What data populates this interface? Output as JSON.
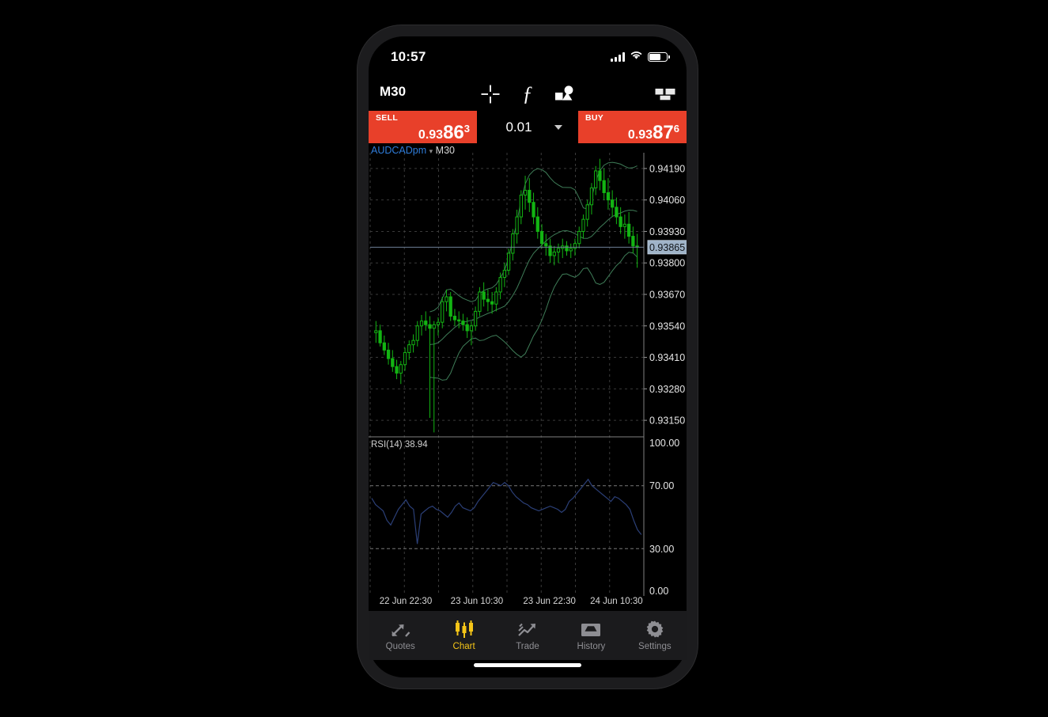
{
  "status_bar": {
    "time": "10:57",
    "signal_icon": "signal-bars-icon",
    "wifi_icon": "wifi-icon",
    "battery_icon": "battery-icon"
  },
  "toolbar": {
    "timeframe_label": "M30",
    "crosshair_icon": "crosshair-icon",
    "indicators_icon": "function-fx-icon",
    "objects_icon": "objects-icon",
    "layout_icon": "chart-layout-icon"
  },
  "trade_bar": {
    "sell": {
      "label": "SELL",
      "price_prefix": "0.93",
      "price_big": "86",
      "price_sup": "3",
      "full_price": "0.93863",
      "color": "#e8402a"
    },
    "buy": {
      "label": "BUY",
      "price_prefix": "0.93",
      "price_big": "87",
      "price_sup": "6",
      "full_price": "0.93876",
      "color": "#e8402a"
    },
    "volume": {
      "value": "0.01",
      "caret_icon": "chevron-down-icon"
    }
  },
  "chart_header": {
    "symbol": "AUDCADpm",
    "symbol_caret": "▾",
    "timeframe": "M30",
    "symbol_color": "#2f7ddb"
  },
  "chart_data": {
    "type": "line",
    "title": "AUDCADpm M30",
    "xlabel": "",
    "ylabel": "",
    "grid": true,
    "legend_position": "none",
    "panes": [
      {
        "name": "price",
        "type": "candlestick",
        "symbol": "AUDCADpm",
        "timeframe": "M30",
        "ylim": [
          0.93085,
          0.94255
        ],
        "yticks": [
          "0.94190",
          "0.94060",
          "0.93930",
          "0.93800",
          "0.93670",
          "0.93540",
          "0.93410",
          "0.93280",
          "0.93150"
        ],
        "ytick_values": [
          0.9419,
          0.9406,
          0.9393,
          0.938,
          0.9367,
          0.9354,
          0.9341,
          0.9328,
          0.9315
        ],
        "current_price": "0.93865",
        "current_price_value": 0.93865,
        "current_price_highlight_bg": "#9fb3c8",
        "bull_color": "#13b413",
        "bear_color": "#13b413",
        "overlays": [
          {
            "name": "Bollinger Upper",
            "color": "#3f7d58"
          },
          {
            "name": "Bollinger Middle",
            "color": "#3f7d58"
          },
          {
            "name": "Bollinger Lower",
            "color": "#3f7d58"
          }
        ],
        "candles": [
          {
            "o": 0.93512,
            "h": 0.9356,
            "l": 0.9347,
            "c": 0.9352
          },
          {
            "o": 0.9352,
            "h": 0.93545,
            "l": 0.93455,
            "c": 0.9347
          },
          {
            "o": 0.9347,
            "h": 0.935,
            "l": 0.9342,
            "c": 0.9344
          },
          {
            "o": 0.9344,
            "h": 0.9347,
            "l": 0.9338,
            "c": 0.93405
          },
          {
            "o": 0.93405,
            "h": 0.9344,
            "l": 0.9335,
            "c": 0.93372
          },
          {
            "o": 0.93372,
            "h": 0.934,
            "l": 0.9332,
            "c": 0.93345
          },
          {
            "o": 0.93345,
            "h": 0.93395,
            "l": 0.933,
            "c": 0.9338
          },
          {
            "o": 0.9338,
            "h": 0.9345,
            "l": 0.93355,
            "c": 0.9343
          },
          {
            "o": 0.9343,
            "h": 0.9348,
            "l": 0.934,
            "c": 0.93462
          },
          {
            "o": 0.93462,
            "h": 0.93505,
            "l": 0.9343,
            "c": 0.9348
          },
          {
            "o": 0.9348,
            "h": 0.9356,
            "l": 0.93455,
            "c": 0.9354
          },
          {
            "o": 0.9354,
            "h": 0.93585,
            "l": 0.935,
            "c": 0.9356
          },
          {
            "o": 0.9356,
            "h": 0.936,
            "l": 0.9352,
            "c": 0.93545
          },
          {
            "o": 0.93545,
            "h": 0.9358,
            "l": 0.9316,
            "c": 0.9353
          },
          {
            "o": 0.9353,
            "h": 0.9356,
            "l": 0.931,
            "c": 0.93545
          },
          {
            "o": 0.93545,
            "h": 0.93575,
            "l": 0.935,
            "c": 0.93555
          },
          {
            "o": 0.93555,
            "h": 0.9366,
            "l": 0.9353,
            "c": 0.9364
          },
          {
            "o": 0.9364,
            "h": 0.9369,
            "l": 0.936,
            "c": 0.9366
          },
          {
            "o": 0.9366,
            "h": 0.9368,
            "l": 0.9356,
            "c": 0.9358
          },
          {
            "o": 0.9358,
            "h": 0.9361,
            "l": 0.9354,
            "c": 0.93565
          },
          {
            "o": 0.93565,
            "h": 0.936,
            "l": 0.9353,
            "c": 0.9356
          },
          {
            "o": 0.9356,
            "h": 0.9359,
            "l": 0.9352,
            "c": 0.93545
          },
          {
            "o": 0.93545,
            "h": 0.93575,
            "l": 0.9349,
            "c": 0.9352
          },
          {
            "o": 0.9352,
            "h": 0.9356,
            "l": 0.9346,
            "c": 0.9354
          },
          {
            "o": 0.9354,
            "h": 0.9362,
            "l": 0.9352,
            "c": 0.936
          },
          {
            "o": 0.936,
            "h": 0.937,
            "l": 0.9358,
            "c": 0.9368
          },
          {
            "o": 0.9368,
            "h": 0.9372,
            "l": 0.9362,
            "c": 0.9365
          },
          {
            "o": 0.9365,
            "h": 0.9369,
            "l": 0.936,
            "c": 0.9364
          },
          {
            "o": 0.9364,
            "h": 0.9368,
            "l": 0.9359,
            "c": 0.9363
          },
          {
            "o": 0.9363,
            "h": 0.937,
            "l": 0.936,
            "c": 0.9368
          },
          {
            "o": 0.9368,
            "h": 0.9376,
            "l": 0.9365,
            "c": 0.9374
          },
          {
            "o": 0.9374,
            "h": 0.938,
            "l": 0.937,
            "c": 0.9377
          },
          {
            "o": 0.9377,
            "h": 0.9386,
            "l": 0.9375,
            "c": 0.9384
          },
          {
            "o": 0.9384,
            "h": 0.9394,
            "l": 0.9381,
            "c": 0.9392
          },
          {
            "o": 0.9392,
            "h": 0.9402,
            "l": 0.9388,
            "c": 0.9399
          },
          {
            "o": 0.9399,
            "h": 0.941,
            "l": 0.9396,
            "c": 0.9408
          },
          {
            "o": 0.9408,
            "h": 0.9416,
            "l": 0.9402,
            "c": 0.941
          },
          {
            "o": 0.941,
            "h": 0.9415,
            "l": 0.9401,
            "c": 0.9405
          },
          {
            "o": 0.9405,
            "h": 0.9409,
            "l": 0.9396,
            "c": 0.9399
          },
          {
            "o": 0.9399,
            "h": 0.9403,
            "l": 0.939,
            "c": 0.9393
          },
          {
            "o": 0.9393,
            "h": 0.9396,
            "l": 0.9386,
            "c": 0.9388
          },
          {
            "o": 0.9388,
            "h": 0.9392,
            "l": 0.9383,
            "c": 0.9387
          },
          {
            "o": 0.9387,
            "h": 0.939,
            "l": 0.938,
            "c": 0.9383
          },
          {
            "o": 0.9383,
            "h": 0.9387,
            "l": 0.9379,
            "c": 0.93845
          },
          {
            "o": 0.93845,
            "h": 0.9388,
            "l": 0.938,
            "c": 0.9386
          },
          {
            "o": 0.9386,
            "h": 0.939,
            "l": 0.9382,
            "c": 0.9387
          },
          {
            "o": 0.9387,
            "h": 0.9389,
            "l": 0.9383,
            "c": 0.9385
          },
          {
            "o": 0.9385,
            "h": 0.9388,
            "l": 0.9382,
            "c": 0.9386
          },
          {
            "o": 0.9386,
            "h": 0.939,
            "l": 0.9383,
            "c": 0.9388
          },
          {
            "o": 0.9388,
            "h": 0.9395,
            "l": 0.9386,
            "c": 0.9393
          },
          {
            "o": 0.9393,
            "h": 0.94,
            "l": 0.939,
            "c": 0.9398
          },
          {
            "o": 0.9398,
            "h": 0.9406,
            "l": 0.9395,
            "c": 0.9404
          },
          {
            "o": 0.9404,
            "h": 0.9413,
            "l": 0.94,
            "c": 0.9411
          },
          {
            "o": 0.9411,
            "h": 0.942,
            "l": 0.9408,
            "c": 0.9418
          },
          {
            "o": 0.9418,
            "h": 0.9423,
            "l": 0.941,
            "c": 0.9414
          },
          {
            "o": 0.9414,
            "h": 0.9419,
            "l": 0.9406,
            "c": 0.9409
          },
          {
            "o": 0.9409,
            "h": 0.9415,
            "l": 0.9402,
            "c": 0.9406
          },
          {
            "o": 0.9406,
            "h": 0.941,
            "l": 0.9399,
            "c": 0.9403
          },
          {
            "o": 0.9403,
            "h": 0.9407,
            "l": 0.9396,
            "c": 0.9399
          },
          {
            "o": 0.9399,
            "h": 0.9403,
            "l": 0.9392,
            "c": 0.9395
          },
          {
            "o": 0.9395,
            "h": 0.94,
            "l": 0.939,
            "c": 0.9396
          },
          {
            "o": 0.9396,
            "h": 0.9401,
            "l": 0.9388,
            "c": 0.9391
          },
          {
            "o": 0.9391,
            "h": 0.9395,
            "l": 0.9384,
            "c": 0.9387
          },
          {
            "o": 0.9387,
            "h": 0.9392,
            "l": 0.9378,
            "c": 0.93865
          }
        ]
      },
      {
        "name": "rsi",
        "type": "line",
        "indicator_label": "RSI(14) 38.94",
        "indicator_name": "RSI",
        "period": 14,
        "current_value": 38.94,
        "ylim": [
          0,
          100
        ],
        "yticks": [
          "100.00",
          "70.00",
          "30.00",
          "0.00"
        ],
        "ytick_values": [
          100.0,
          70.0,
          30.0,
          0.0
        ],
        "line_color": "#2b3f77",
        "level_lines": [
          70,
          30
        ],
        "values": [
          62,
          58,
          56,
          54,
          48,
          45,
          50,
          55,
          58,
          61,
          57,
          55,
          33,
          52,
          54,
          56,
          57,
          55,
          54,
          52,
          50,
          53,
          57,
          59,
          56,
          55,
          54,
          56,
          60,
          63,
          66,
          69,
          72,
          71,
          70,
          72,
          70,
          66,
          63,
          61,
          59,
          58,
          56,
          55,
          54,
          55,
          56,
          57,
          56,
          55,
          53,
          55,
          60,
          62,
          65,
          68,
          71,
          74,
          70,
          68,
          66,
          64,
          62,
          60,
          63,
          62,
          60,
          58,
          55,
          48,
          42,
          38.94
        ]
      }
    ],
    "xticks": [
      "22 Jun 22:30",
      "23 Jun 10:30",
      "23 Jun 22:30",
      "24 Jun 10:30"
    ]
  },
  "tabbar": {
    "items": [
      {
        "label": "Quotes",
        "icon": "quotes-arrows-icon",
        "active": false
      },
      {
        "label": "Chart",
        "icon": "candlestick-icon",
        "active": true
      },
      {
        "label": "Trade",
        "icon": "trade-trend-icon",
        "active": false
      },
      {
        "label": "History",
        "icon": "history-tray-icon",
        "active": false
      },
      {
        "label": "Settings",
        "icon": "gear-icon",
        "active": false
      }
    ],
    "active_color": "#f5c518",
    "inactive_color": "#8e8e93"
  }
}
